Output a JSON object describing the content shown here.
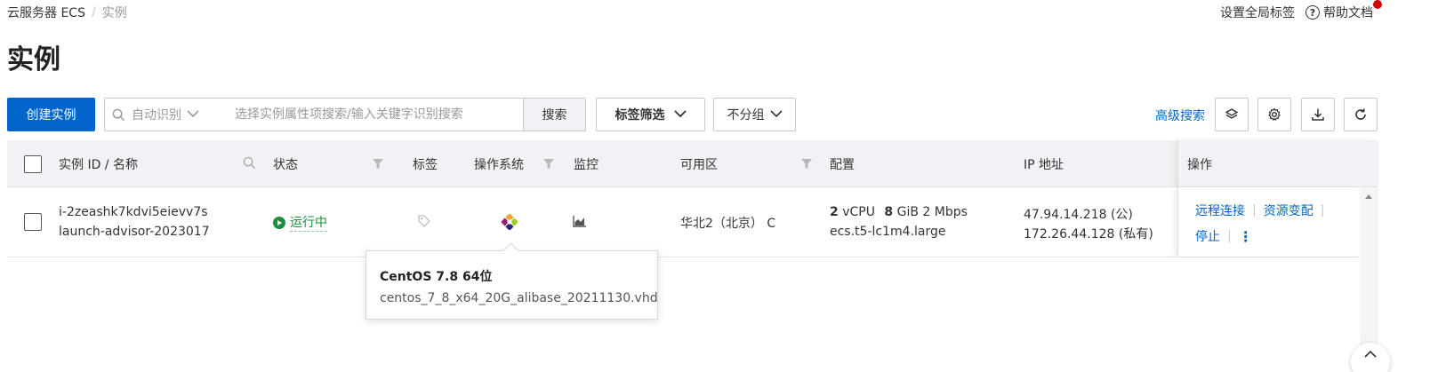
{
  "breadcrumb": {
    "parent": "云服务器 ECS",
    "separator": "/",
    "current": "实例"
  },
  "top_links": {
    "global_tags": "设置全局标签",
    "help_icon": "?",
    "help_docs": "帮助文档"
  },
  "page_title": "实例",
  "toolbar": {
    "create_button": "创建实例",
    "search_mode": "自动识别",
    "search_placeholder": "选择实例属性项搜索/输入关键字识别搜索",
    "search_button": "搜索",
    "tag_filter": "标签筛选",
    "group": "不分组",
    "advanced_search": "高级搜索",
    "icon_buttons": [
      "layers-icon",
      "gear-icon",
      "download-icon",
      "refresh-icon"
    ]
  },
  "table": {
    "headers": {
      "id_name": "实例 ID / 名称",
      "status": "状态",
      "tags": "标签",
      "os": "操作系统",
      "monitor": "监控",
      "zone": "可用区",
      "config": "配置",
      "ip": "IP 地址",
      "actions": "操作"
    },
    "rows": [
      {
        "id": "i-2zeashk7kdvi5eievv7s",
        "name": "launch-advisor-2023017",
        "status": "运行中",
        "zone": "华北2（北京） C",
        "config_cpu_num": "2",
        "config_cpu_unit": "vCPU",
        "config_mem_num": "8",
        "config_mem_unit": "GiB 2 Mbps",
        "instance_type": "ecs.t5-lc1m4.large",
        "ip_public": "47.94.14.218 (公)",
        "ip_private": "172.26.44.128 (私有)",
        "actions": {
          "remote_connect": "远程连接",
          "resize": "资源变配",
          "stop": "停止",
          "more": "⋮"
        }
      }
    ]
  },
  "tooltip": {
    "title": "CentOS 7.8 64位",
    "image": "centos_7_8_x64_20G_alibase_20211130.vhd"
  },
  "colors": {
    "primary": "#0064c8",
    "running": "#1e8e3e",
    "header_bg": "#f0f2f5",
    "alert": "#d50000"
  }
}
